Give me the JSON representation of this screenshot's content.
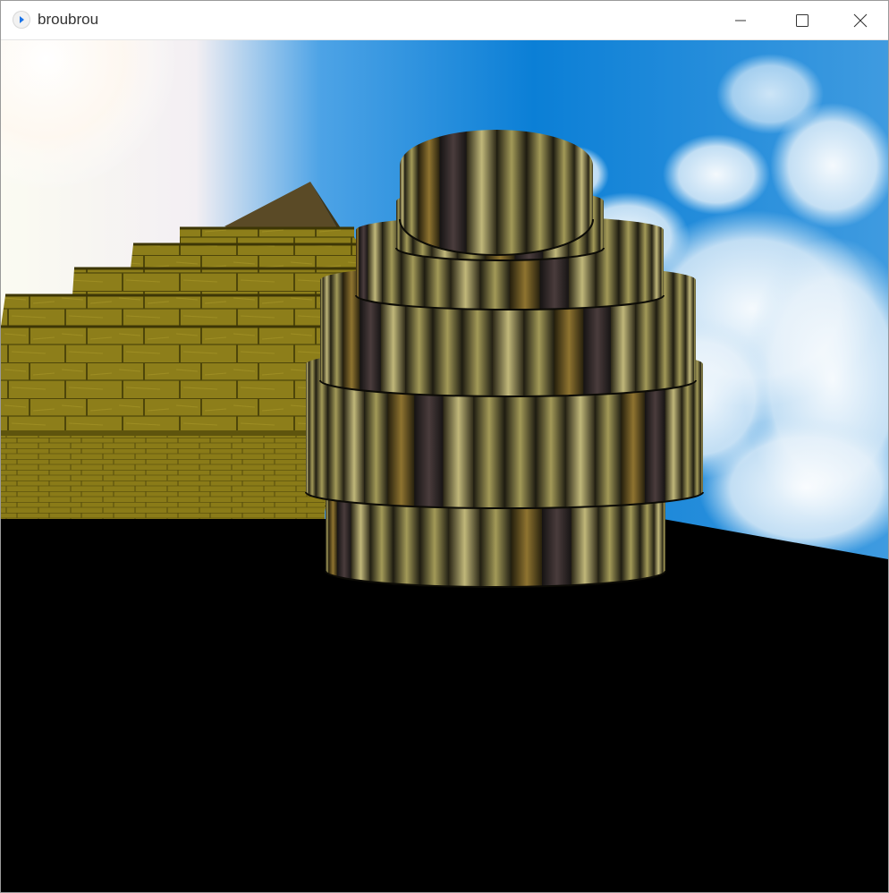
{
  "window": {
    "title": "broubrou",
    "app_icon": "play-app-icon",
    "controls": {
      "minimize_icon": "minimize-icon",
      "maximize_icon": "maximize-icon",
      "close_icon": "close-icon"
    }
  },
  "scene": {
    "sky_colors": {
      "top": "#0b7fd6",
      "light": "#fdfdf5",
      "cloud": "#eaf4fb"
    },
    "ground_color": "#000000",
    "pyramid_color": "#8a7a1a",
    "tower_color": "#6e6a3a"
  }
}
